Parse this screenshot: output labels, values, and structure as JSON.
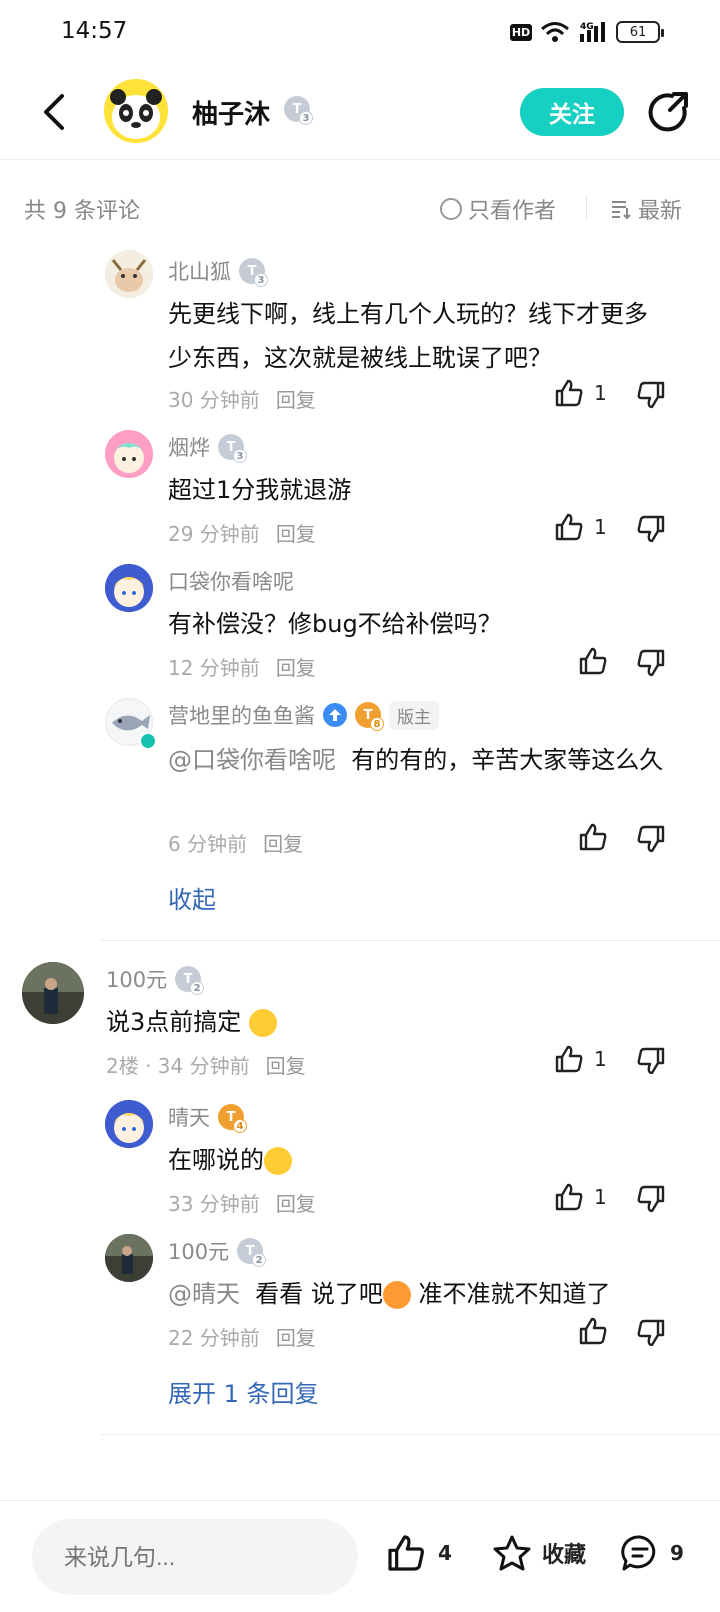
{
  "status": {
    "time": "14:57",
    "hd": "HD",
    "network": "4G",
    "battery": "61"
  },
  "header": {
    "author": "柚子沐",
    "author_level": "3",
    "follow_label": "关注"
  },
  "subbar": {
    "count": "共 9 条评论",
    "author_only": "只看作者",
    "sort": "最新"
  },
  "comments": [
    {
      "user": "北山狐",
      "level": "3",
      "text": "先更线下啊，线上有几个人玩的？线下才更多少东西，这次就是被线上耽误了吧？",
      "time": "30 分钟前",
      "reply": "回复",
      "likes": "1"
    },
    {
      "user": "烟烨",
      "level": "3",
      "text": "超过1分我就退游",
      "time": "29 分钟前",
      "reply": "回复",
      "likes": "1"
    },
    {
      "user": "口袋你看啥呢",
      "text": "有补偿没？修bug不给补偿吗？",
      "time": "12 分钟前",
      "reply": "回复"
    },
    {
      "user": "营地里的鱼鱼酱",
      "level": "8",
      "role": "版主",
      "mention": "@口袋你看啥呢",
      "text": "有的有的，辛苦大家等这么久",
      "time": "6 分钟前",
      "reply": "回复"
    }
  ],
  "collapse_label": "收起",
  "floor2": {
    "user": "100元",
    "level": "2",
    "text": "说3点前搞定",
    "meta": "2楼 · 34 分钟前",
    "reply": "回复",
    "likes": "1",
    "replies": [
      {
        "user": "晴天",
        "level": "4",
        "text": "在哪说的",
        "time": "33 分钟前",
        "reply": "回复",
        "likes": "1"
      },
      {
        "user": "100元",
        "level": "2",
        "mention": "@晴天",
        "text": "看看 说了吧",
        "text2": "准不准就不知道了",
        "time": "22 分钟前",
        "reply": "回复"
      }
    ],
    "expand_label": "展开 1 条回复"
  },
  "bottom": {
    "placeholder": "来说几句...",
    "likes": "4",
    "fav_label": "收藏",
    "comments": "9"
  },
  "colors": {
    "accent": "#16d0c2",
    "link": "#3569b8"
  }
}
